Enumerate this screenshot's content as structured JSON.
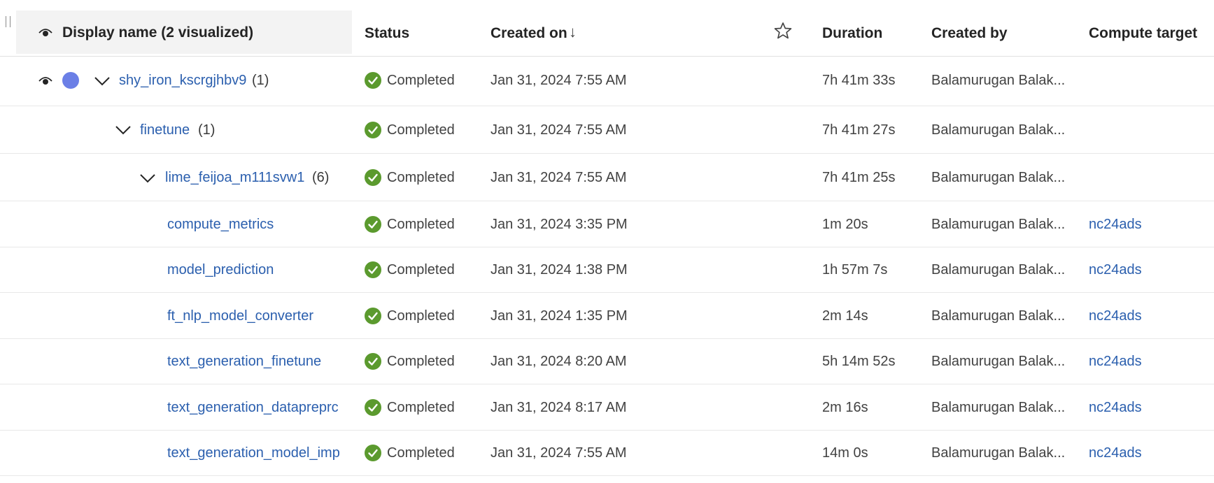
{
  "header": {
    "display_name": "Display name (2 visualized)",
    "status": "Status",
    "created_on": "Created on",
    "sort_arrow": "↓",
    "duration": "Duration",
    "created_by": "Created by",
    "compute_target": "Compute target"
  },
  "colors": {
    "link": "#2b5fae",
    "status_ok": "#5b9a2e",
    "vis_dot": "#6b7fe6",
    "header_bg": "#f3f3f3"
  },
  "rows": [
    {
      "name": "shy_iron_kscrgjhbv9",
      "count": "(1)",
      "status": "Completed",
      "created_on": "Jan 31, 2024 7:55 AM",
      "duration": "7h 41m 33s",
      "created_by": "Balamurugan Balak...",
      "compute": ""
    },
    {
      "name": "finetune",
      "count": "(1)",
      "status": "Completed",
      "created_on": "Jan 31, 2024 7:55 AM",
      "duration": "7h 41m 27s",
      "created_by": "Balamurugan Balak...",
      "compute": ""
    },
    {
      "name": "lime_feijoa_m111svw1",
      "count": "(6)",
      "status": "Completed",
      "created_on": "Jan 31, 2024 7:55 AM",
      "duration": "7h 41m 25s",
      "created_by": "Balamurugan Balak...",
      "compute": ""
    },
    {
      "name": "compute_metrics",
      "count": "",
      "status": "Completed",
      "created_on": "Jan 31, 2024 3:35 PM",
      "duration": "1m 20s",
      "created_by": "Balamurugan Balak...",
      "compute": "nc24ads"
    },
    {
      "name": "model_prediction",
      "count": "",
      "status": "Completed",
      "created_on": "Jan 31, 2024 1:38 PM",
      "duration": "1h 57m 7s",
      "created_by": "Balamurugan Balak...",
      "compute": "nc24ads"
    },
    {
      "name": "ft_nlp_model_converter",
      "count": "",
      "status": "Completed",
      "created_on": "Jan 31, 2024 1:35 PM",
      "duration": "2m 14s",
      "created_by": "Balamurugan Balak...",
      "compute": "nc24ads"
    },
    {
      "name": "text_generation_finetune",
      "count": "",
      "status": "Completed",
      "created_on": "Jan 31, 2024 8:20 AM",
      "duration": "5h 14m 52s",
      "created_by": "Balamurugan Balak...",
      "compute": "nc24ads"
    },
    {
      "name": "text_generation_datapreprc",
      "count": "",
      "status": "Completed",
      "created_on": "Jan 31, 2024 8:17 AM",
      "duration": "2m 16s",
      "created_by": "Balamurugan Balak...",
      "compute": "nc24ads"
    },
    {
      "name": "text_generation_model_imp",
      "count": "",
      "status": "Completed",
      "created_on": "Jan 31, 2024 7:55 AM",
      "duration": "14m 0s",
      "created_by": "Balamurugan Balak...",
      "compute": "nc24ads"
    }
  ]
}
